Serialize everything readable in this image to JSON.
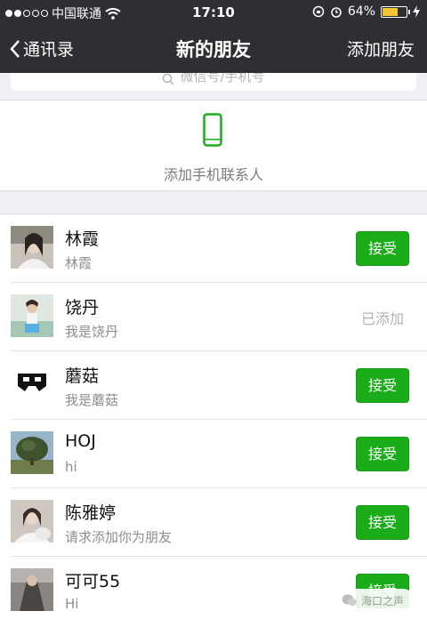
{
  "status_bar": {
    "carrier": "中国联通",
    "time": "17:10",
    "battery": "64%",
    "battery_level": 0.64
  },
  "nav": {
    "back_label": "通讯录",
    "title": "新的朋友",
    "add_label": "添加朋友"
  },
  "search": {
    "placeholder": "微信号/手机号"
  },
  "add_contacts": {
    "label": "添加手机联系人"
  },
  "requests": [
    {
      "name": "林霞",
      "message": "林霞",
      "action": "接受",
      "status": "accept"
    },
    {
      "name": "饶丹",
      "message": "我是饶丹",
      "action": "已添加",
      "status": "added"
    },
    {
      "name": "蘑菇",
      "message": "我是蘑菇",
      "action": "接受",
      "status": "accept"
    },
    {
      "name": "HOJ",
      "message": "hi",
      "action": "接受",
      "status": "accept"
    },
    {
      "name": "陈雅婷",
      "message": "请求添加你为朋友",
      "action": "接受",
      "status": "accept"
    },
    {
      "name": "可可55",
      "message": "Hi",
      "action": "接受",
      "status": "accept"
    }
  ],
  "watermark": "海口之声",
  "colors": {
    "accent_green": "#1aad19",
    "nav_bg": "#2f2f33"
  }
}
